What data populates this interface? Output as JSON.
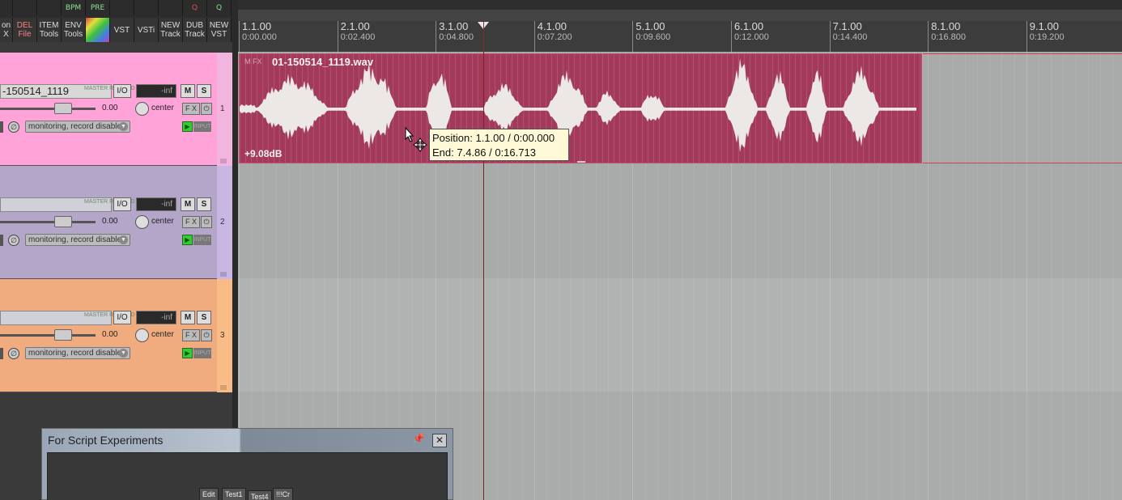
{
  "toolbar": {
    "buttons": [
      {
        "l1": "on",
        "l2": "X",
        "color": "#dddddd"
      },
      {
        "l1": "DEL",
        "l2": "File",
        "color": "#ff8080"
      },
      {
        "l1": "ITEM",
        "l2": "Tools",
        "color": "#dddddd"
      },
      {
        "l1": "ENV",
        "l2": "Tools",
        "color": "#dddddd"
      },
      {
        "l1": "",
        "l2": "",
        "color": "#dddddd"
      },
      {
        "l1": "VST",
        "l2": "",
        "color": "#dddddd"
      },
      {
        "l1": "VSTi",
        "l2": "",
        "color": "#dddddd"
      },
      {
        "l1": "NEW",
        "l2": "Track",
        "color": "#dddddd"
      },
      {
        "l1": "DUB",
        "l2": "Track",
        "color": "#dddddd"
      },
      {
        "l1": "NEW",
        "l2": "VST",
        "color": "#dddddd"
      }
    ],
    "top_icons": [
      "",
      "",
      "",
      "BPM",
      "PRE",
      "",
      "",
      "",
      "Q",
      "Q"
    ]
  },
  "tracks": [
    {
      "number": "1",
      "name": "-150514_1119",
      "volume": "-inf",
      "fader_value": "0.00",
      "pan": "center",
      "monitoring": "monitoring, record disabled",
      "io": "I/O",
      "mute": "M",
      "solo": "S",
      "fx": "F X",
      "master_send": "MASTER RCV SND",
      "color": "#ffa3d9",
      "stripe": "#f2b5e0"
    },
    {
      "number": "2",
      "name": "",
      "volume": "-inf",
      "fader_value": "0.00",
      "pan": "center",
      "monitoring": "monitoring, record disabled",
      "io": "I/O",
      "mute": "M",
      "solo": "S",
      "fx": "F X",
      "master_send": "MASTER RCV SND",
      "color": "#b3a6c8",
      "stripe": "#c9b6e3"
    },
    {
      "number": "3",
      "name": "",
      "volume": "-inf",
      "fader_value": "0.00",
      "pan": "center",
      "monitoring": "monitoring, record disabled",
      "io": "I/O",
      "mute": "M",
      "solo": "S",
      "fx": "F X",
      "master_send": "MASTER RCV SND",
      "color": "#f0ac7e",
      "stripe": "#f9bc86"
    }
  ],
  "ruler": {
    "marks": [
      {
        "bar": "1.1.00",
        "time": "0:00.000"
      },
      {
        "bar": "2.1.00",
        "time": "0:02.400"
      },
      {
        "bar": "3.1.00",
        "time": "0:04.800"
      },
      {
        "bar": "4.1.00",
        "time": "0:07.200"
      },
      {
        "bar": "5.1.00",
        "time": "0:09.600"
      },
      {
        "bar": "6.1.00",
        "time": "0:12.000"
      },
      {
        "bar": "7.1.00",
        "time": "0:14.400"
      },
      {
        "bar": "8.1.00",
        "time": "0:16.800"
      },
      {
        "bar": "9.1.00",
        "time": "0:19.200"
      }
    ]
  },
  "item": {
    "name": "01-150514_1119.wav",
    "gain": "+9.08dB",
    "flags": "M FX",
    "color": "#a33a5c"
  },
  "tooltip": {
    "line1": "Position: 1.1.00 / 0:00.000",
    "line2": "End: 7.4.86 / 0:16.713"
  },
  "script_window": {
    "title": "For Script Experiments",
    "buttons": [
      "Edit",
      "Test1",
      "Test4",
      "!!!Cr"
    ]
  }
}
